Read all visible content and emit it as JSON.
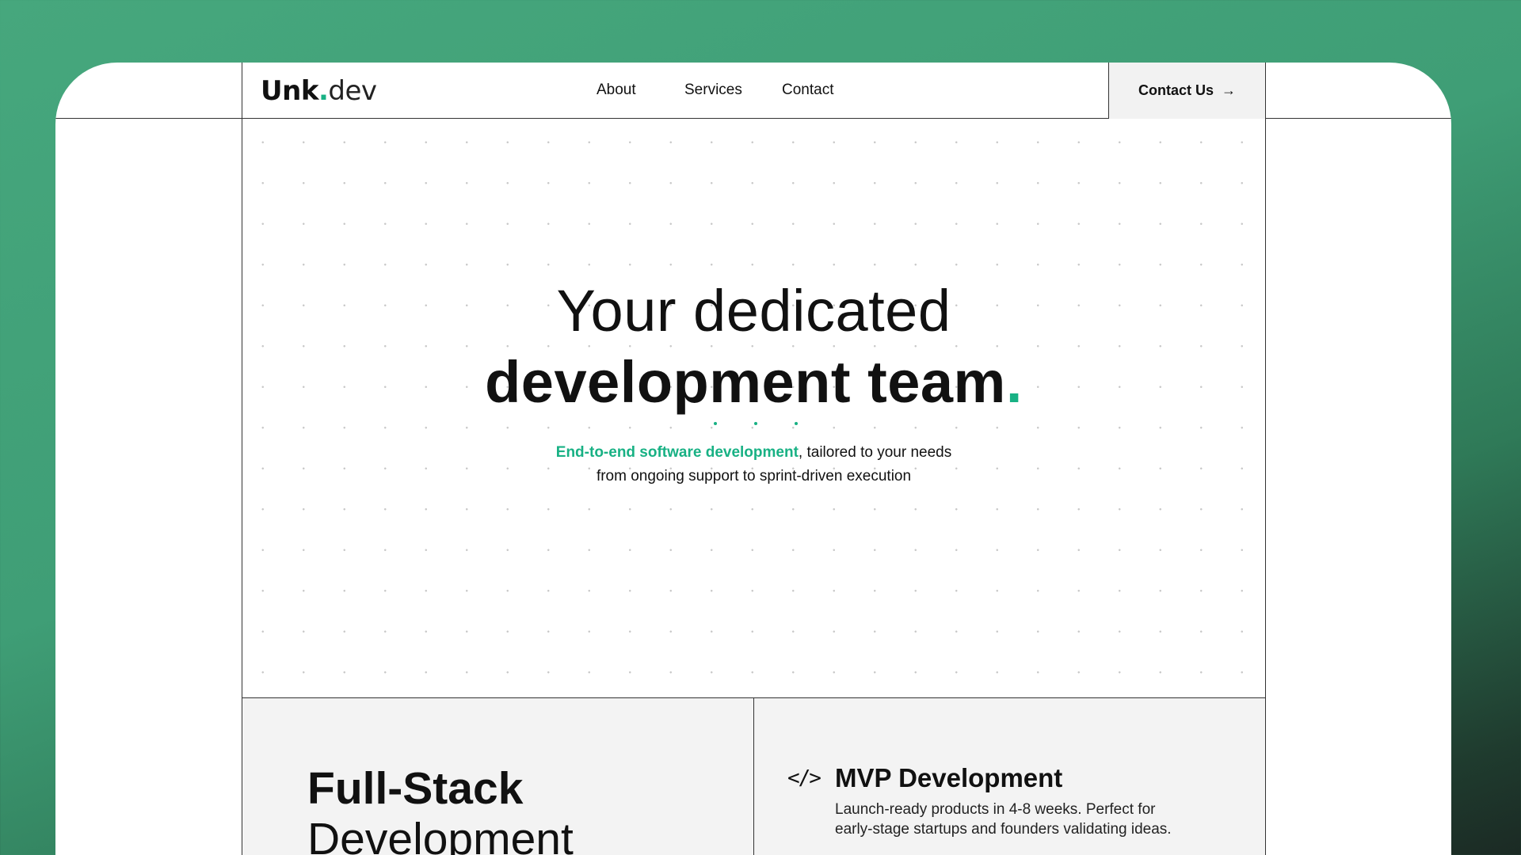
{
  "logo": {
    "brand": "Unk",
    "dot": ".",
    "tld": "dev"
  },
  "nav": {
    "items": [
      {
        "label": "About"
      },
      {
        "label": "Services"
      },
      {
        "label": "Contact"
      }
    ]
  },
  "cta": {
    "label": "Contact Us",
    "icon": "arrow-right-icon"
  },
  "hero": {
    "title_line1": "Your dedicated",
    "title_line2": "development team",
    "title_dot": ".",
    "subtitle_highlight": "End-to-end software development",
    "subtitle_rest": ", tailored to your needs",
    "subtitle_line2": "from ongoing support to sprint-driven execution"
  },
  "services": {
    "left_title_bold": "Full-Stack",
    "left_title_normal": "Development",
    "right_icon": "code-icon",
    "right_title": "MVP Development",
    "right_desc_line1": "Launch-ready products in 4-8 weeks. Perfect for",
    "right_desc_line2": "early-stage startups and founders validating ideas."
  },
  "colors": {
    "accent": "#18b184",
    "background_gradient_start": "#46a77d",
    "background_gradient_end": "#1b2a24",
    "card_bg": "#f3f3f3"
  }
}
